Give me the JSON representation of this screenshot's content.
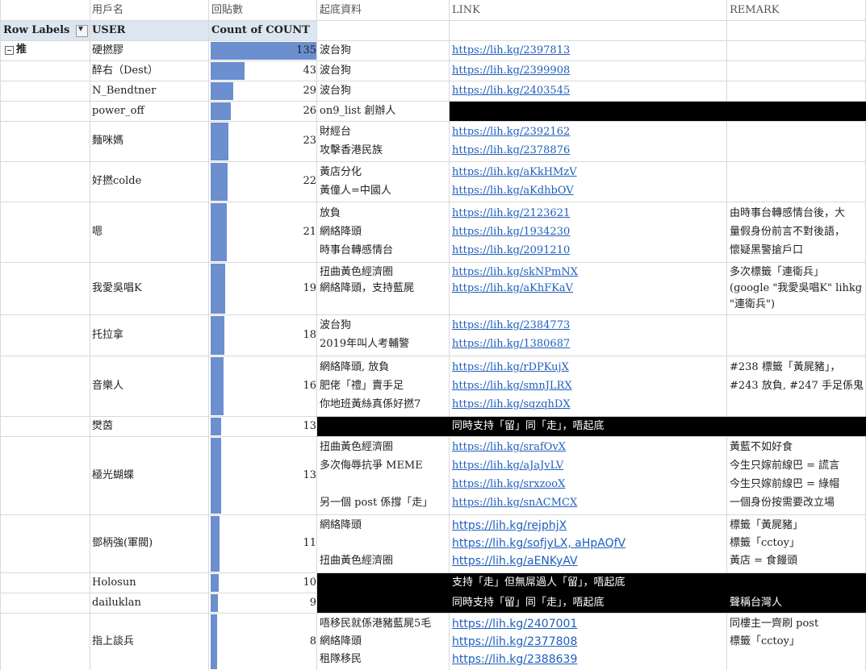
{
  "top_headers": {
    "user": "用戶名",
    "count": "回貼數",
    "origin": "起底資料",
    "link": "LINK",
    "remark": "REMARK"
  },
  "pivot_headers": {
    "row_labels": "Row Labels",
    "user": "USER",
    "count": "Count of COUNT"
  },
  "group_label": "推",
  "count_max": 135,
  "rows": [
    {
      "user": "硬撚膠",
      "count": 135,
      "origin": [
        "波台狗"
      ],
      "links": [
        "https://lih.kg/2397813"
      ],
      "remark": []
    },
    {
      "user": "醉右（Dest）",
      "count": 43,
      "origin": [
        "波台狗"
      ],
      "links": [
        "https://lih.kg/2399908"
      ],
      "remark": []
    },
    {
      "user": "N_Bendtner",
      "count": 29,
      "origin": [
        "波台狗"
      ],
      "links": [
        "https://lih.kg/2403545"
      ],
      "remark": []
    },
    {
      "user": "power_off",
      "count": 26,
      "origin": [
        "on9_list 創辦人"
      ],
      "links": [],
      "remark": []
    },
    {
      "user": "麵咪媽",
      "count": 23,
      "origin": [
        "財經台",
        "攻擊香港民族"
      ],
      "links": [
        "https://lih.kg/2392162",
        "https://lih.kg/2378876"
      ],
      "remark": []
    },
    {
      "user": "好撚colde",
      "count": 22,
      "origin": [
        "黃店分化",
        "黃僮人=中國人"
      ],
      "links": [
        "https://lih.kg/aKkHMzV",
        "https://lih.kg/aKdhbOV"
      ],
      "remark": []
    },
    {
      "user": "嗯",
      "count": 21,
      "origin": [
        "放負",
        "網絡降頭",
        "時事台轉感情台"
      ],
      "links": [
        "https://lih.kg/2123621",
        "https://lih.kg/1934230",
        "https://lih.kg/2091210"
      ],
      "remark": [
        "由時事台轉感情台後，大",
        "量假身份前言不對後語，",
        "懷疑黑警搶戶口"
      ]
    },
    {
      "user": "我愛吳唱K",
      "count": 19,
      "origin": [
        "扭曲黃色經濟圈",
        "網絡降頭，支持藍屍"
      ],
      "links": [
        "https://lih.kg/skNPmNX",
        "https://lih.kg/aKhFKaV"
      ],
      "remark": [
        "多次標籤「連衛兵」",
        "(google \"我愛吳唱K\" lihkg",
        "\"連衛兵\")"
      ]
    },
    {
      "user": "托拉拿",
      "count": 18,
      "origin": [
        "波台狗",
        "2019年叫人考輔警"
      ],
      "links": [
        "https://lih.kg/2384773",
        "https://lih.kg/1380687"
      ],
      "remark": []
    },
    {
      "user": "音樂人",
      "count": 16,
      "origin": [
        "網絡降頭, 放負",
        "肥佬「禮」賣手足",
        "你地班黃絲真係好撚7"
      ],
      "links": [
        "https://lih.kg/rDPKujX",
        "https://lih.kg/smnJLRX",
        "https://lih.kg/sqzqhDX"
      ],
      "remark": [
        "#238 標籤「黃屍豬」，",
        "#243 放負, #247 手足係鬼"
      ]
    },
    {
      "user": "燓茵",
      "count": 13,
      "origin": [],
      "links": [],
      "remark": [],
      "banner": "同時支持「留」同「走」，唔起底"
    },
    {
      "user": "極光蝴蝶",
      "count": 13,
      "origin": [
        "扭曲黃色經濟圈",
        "多次侮辱抗爭 MEME",
        "",
        "另一個 post 係撐「走」"
      ],
      "links": [
        "https://lih.kg/srafOvX",
        "https://lih.kg/aJaJvLV",
        "https://lih.kg/srxzooX",
        "https://lih.kg/snACMCX"
      ],
      "remark": [
        "黃藍不如好食",
        "今生只嫁前線巴 = 謊言",
        "今生只嫁前線巴 = 綠帽",
        "一個身份按需要改立場"
      ]
    },
    {
      "user": "鄧柄強(軍閥)",
      "count": 11,
      "origin": [
        "網絡降頭",
        "",
        "扭曲黃色經濟圈"
      ],
      "links": [
        "https://lih.kg/rejphjX",
        "https://lih.kg/sofjyLX, aHpAQfV",
        "https://lih.kg/aENKyAV"
      ],
      "remark": [
        "標籤「黃屍豬」",
        "標籤「cctoy」",
        "黃店 = 食饅頭"
      ]
    },
    {
      "user": "Holosun",
      "count": 10,
      "origin": [],
      "links": [],
      "remark": [],
      "banner": "支持「走」但無屌過人「留」，唔起底"
    },
    {
      "user": "dailuklan",
      "count": 9,
      "origin": [],
      "links": [],
      "remark": [
        "聲稱台灣人"
      ],
      "banner": "同時支持「留」同「走」，唔起底"
    },
    {
      "user": "指上談兵",
      "count": 8,
      "origin": [
        "唔移民就係港豬藍屍5毛",
        "網絡降頭",
        "租隊移民"
      ],
      "links": [
        "https://lih.kg/2407001",
        "https://lih.kg/2377808",
        "https://lih.kg/2388639"
      ],
      "remark": [
        "同樓主一齊刷 post",
        "標籤「cctoy」"
      ]
    }
  ]
}
